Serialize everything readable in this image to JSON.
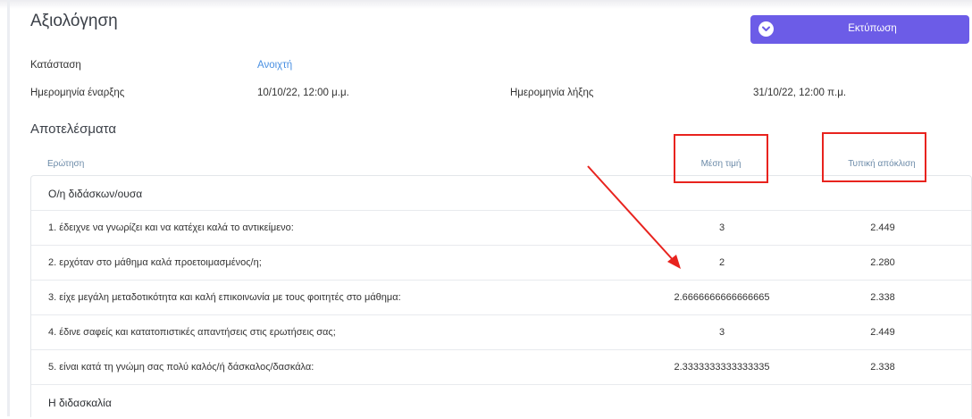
{
  "header": {
    "title": "Αξιολόγηση",
    "print_label": "Εκτύπωση",
    "print_icon": "chevron-down-circle-icon"
  },
  "meta": {
    "status_label": "Κατάσταση",
    "status_value": "Ανοιχτή",
    "start_label": "Ημερομηνία έναρξης",
    "start_value": "10/10/22, 12:00 μ.μ.",
    "end_label": "Ημερομηνία λήξης",
    "end_value": "31/10/22, 12:00 π.μ."
  },
  "results": {
    "title": "Αποτελέσματα",
    "columns": {
      "question": "Ερώτηση",
      "mean": "Μέση τιμή",
      "std": "Τυπική απόκλιση"
    },
    "rows": [
      {
        "type": "group",
        "question": "Ο/η διδάσκων/ουσα",
        "mean": "",
        "std": ""
      },
      {
        "type": "item",
        "question": "1. έδειχνε να γνωρίζει και να κατέχει καλά το αντικείμενο:",
        "mean": "3",
        "std": "2.449"
      },
      {
        "type": "item",
        "question": "2. ερχόταν στο μάθημα καλά προετοιμασμένος/η;",
        "mean": "2",
        "std": "2.280"
      },
      {
        "type": "item",
        "question": "3. είχε μεγάλη μεταδοτικότητα και καλή επικοινωνία με τους φοιτητές στο μάθημα:",
        "mean": "2.6666666666666665",
        "std": "2.338"
      },
      {
        "type": "item",
        "question": "4. έδινε σαφείς και κατατοπιστικές απαντήσεις στις ερωτήσεις σας;",
        "mean": "3",
        "std": "2.449"
      },
      {
        "type": "item",
        "question": "5. είναι κατά τη γνώμη σας πολύ καλός/ή δάσκαλος/δασκάλα:",
        "mean": "2.3333333333333335",
        "std": "2.338"
      },
      {
        "type": "group",
        "question": "Η διδασκαλία",
        "mean": "",
        "std": ""
      }
    ]
  },
  "colors": {
    "accent": "#6c5ce7",
    "link": "#4a90e2",
    "annotation": "#e8231e"
  }
}
